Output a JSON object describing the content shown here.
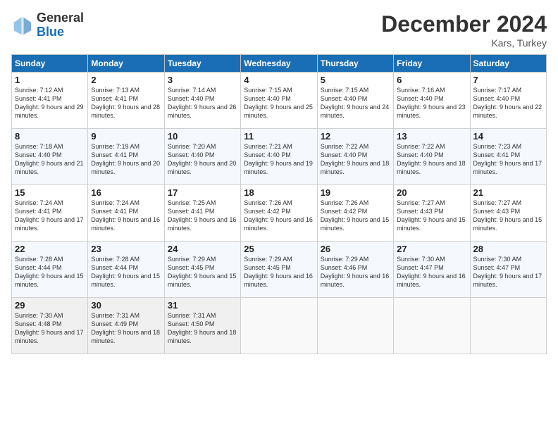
{
  "logo": {
    "general": "General",
    "blue": "Blue"
  },
  "title": "December 2024",
  "subtitle": "Kars, Turkey",
  "days_of_week": [
    "Sunday",
    "Monday",
    "Tuesday",
    "Wednesday",
    "Thursday",
    "Friday",
    "Saturday"
  ],
  "weeks": [
    [
      {
        "day": "1",
        "sunrise": "Sunrise: 7:12 AM",
        "sunset": "Sunset: 4:41 PM",
        "daylight": "Daylight: 9 hours and 29 minutes."
      },
      {
        "day": "2",
        "sunrise": "Sunrise: 7:13 AM",
        "sunset": "Sunset: 4:41 PM",
        "daylight": "Daylight: 9 hours and 28 minutes."
      },
      {
        "day": "3",
        "sunrise": "Sunrise: 7:14 AM",
        "sunset": "Sunset: 4:40 PM",
        "daylight": "Daylight: 9 hours and 26 minutes."
      },
      {
        "day": "4",
        "sunrise": "Sunrise: 7:15 AM",
        "sunset": "Sunset: 4:40 PM",
        "daylight": "Daylight: 9 hours and 25 minutes."
      },
      {
        "day": "5",
        "sunrise": "Sunrise: 7:15 AM",
        "sunset": "Sunset: 4:40 PM",
        "daylight": "Daylight: 9 hours and 24 minutes."
      },
      {
        "day": "6",
        "sunrise": "Sunrise: 7:16 AM",
        "sunset": "Sunset: 4:40 PM",
        "daylight": "Daylight: 9 hours and 23 minutes."
      },
      {
        "day": "7",
        "sunrise": "Sunrise: 7:17 AM",
        "sunset": "Sunset: 4:40 PM",
        "daylight": "Daylight: 9 hours and 22 minutes."
      }
    ],
    [
      {
        "day": "8",
        "sunrise": "Sunrise: 7:18 AM",
        "sunset": "Sunset: 4:40 PM",
        "daylight": "Daylight: 9 hours and 21 minutes."
      },
      {
        "day": "9",
        "sunrise": "Sunrise: 7:19 AM",
        "sunset": "Sunset: 4:41 PM",
        "daylight": "Daylight: 9 hours and 20 minutes."
      },
      {
        "day": "10",
        "sunrise": "Sunrise: 7:20 AM",
        "sunset": "Sunset: 4:40 PM",
        "daylight": "Daylight: 9 hours and 20 minutes."
      },
      {
        "day": "11",
        "sunrise": "Sunrise: 7:21 AM",
        "sunset": "Sunset: 4:40 PM",
        "daylight": "Daylight: 9 hours and 19 minutes."
      },
      {
        "day": "12",
        "sunrise": "Sunrise: 7:22 AM",
        "sunset": "Sunset: 4:40 PM",
        "daylight": "Daylight: 9 hours and 18 minutes."
      },
      {
        "day": "13",
        "sunrise": "Sunrise: 7:22 AM",
        "sunset": "Sunset: 4:40 PM",
        "daylight": "Daylight: 9 hours and 18 minutes."
      },
      {
        "day": "14",
        "sunrise": "Sunrise: 7:23 AM",
        "sunset": "Sunset: 4:41 PM",
        "daylight": "Daylight: 9 hours and 17 minutes."
      }
    ],
    [
      {
        "day": "15",
        "sunrise": "Sunrise: 7:24 AM",
        "sunset": "Sunset: 4:41 PM",
        "daylight": "Daylight: 9 hours and 17 minutes."
      },
      {
        "day": "16",
        "sunrise": "Sunrise: 7:24 AM",
        "sunset": "Sunset: 4:41 PM",
        "daylight": "Daylight: 9 hours and 16 minutes."
      },
      {
        "day": "17",
        "sunrise": "Sunrise: 7:25 AM",
        "sunset": "Sunset: 4:41 PM",
        "daylight": "Daylight: 9 hours and 16 minutes."
      },
      {
        "day": "18",
        "sunrise": "Sunrise: 7:26 AM",
        "sunset": "Sunset: 4:42 PM",
        "daylight": "Daylight: 9 hours and 16 minutes."
      },
      {
        "day": "19",
        "sunrise": "Sunrise: 7:26 AM",
        "sunset": "Sunset: 4:42 PM",
        "daylight": "Daylight: 9 hours and 15 minutes."
      },
      {
        "day": "20",
        "sunrise": "Sunrise: 7:27 AM",
        "sunset": "Sunset: 4:43 PM",
        "daylight": "Daylight: 9 hours and 15 minutes."
      },
      {
        "day": "21",
        "sunrise": "Sunrise: 7:27 AM",
        "sunset": "Sunset: 4:43 PM",
        "daylight": "Daylight: 9 hours and 15 minutes."
      }
    ],
    [
      {
        "day": "22",
        "sunrise": "Sunrise: 7:28 AM",
        "sunset": "Sunset: 4:44 PM",
        "daylight": "Daylight: 9 hours and 15 minutes."
      },
      {
        "day": "23",
        "sunrise": "Sunrise: 7:28 AM",
        "sunset": "Sunset: 4:44 PM",
        "daylight": "Daylight: 9 hours and 15 minutes."
      },
      {
        "day": "24",
        "sunrise": "Sunrise: 7:29 AM",
        "sunset": "Sunset: 4:45 PM",
        "daylight": "Daylight: 9 hours and 15 minutes."
      },
      {
        "day": "25",
        "sunrise": "Sunrise: 7:29 AM",
        "sunset": "Sunset: 4:45 PM",
        "daylight": "Daylight: 9 hours and 16 minutes."
      },
      {
        "day": "26",
        "sunrise": "Sunrise: 7:29 AM",
        "sunset": "Sunset: 4:46 PM",
        "daylight": "Daylight: 9 hours and 16 minutes."
      },
      {
        "day": "27",
        "sunrise": "Sunrise: 7:30 AM",
        "sunset": "Sunset: 4:47 PM",
        "daylight": "Daylight: 9 hours and 16 minutes."
      },
      {
        "day": "28",
        "sunrise": "Sunrise: 7:30 AM",
        "sunset": "Sunset: 4:47 PM",
        "daylight": "Daylight: 9 hours and 17 minutes."
      }
    ],
    [
      {
        "day": "29",
        "sunrise": "Sunrise: 7:30 AM",
        "sunset": "Sunset: 4:48 PM",
        "daylight": "Daylight: 9 hours and 17 minutes."
      },
      {
        "day": "30",
        "sunrise": "Sunrise: 7:31 AM",
        "sunset": "Sunset: 4:49 PM",
        "daylight": "Daylight: 9 hours and 18 minutes."
      },
      {
        "day": "31",
        "sunrise": "Sunrise: 7:31 AM",
        "sunset": "Sunset: 4:50 PM",
        "daylight": "Daylight: 9 hours and 18 minutes."
      },
      null,
      null,
      null,
      null
    ]
  ]
}
